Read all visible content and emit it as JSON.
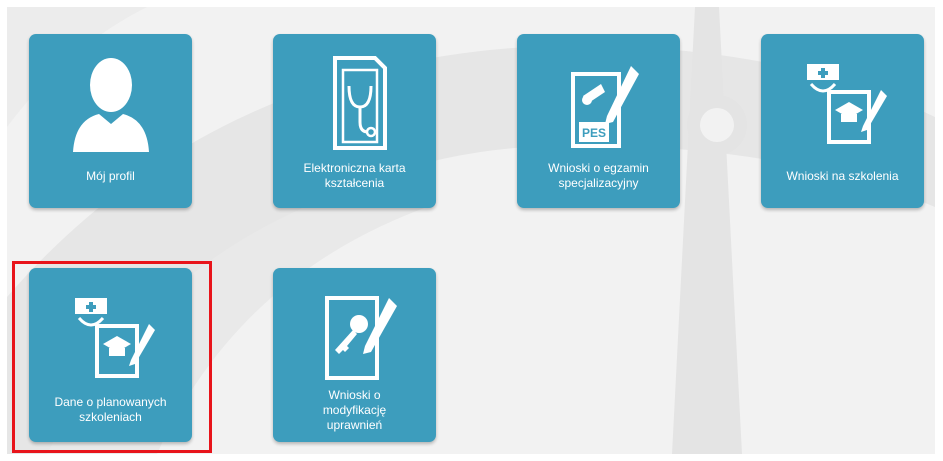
{
  "tiles": [
    {
      "id": "profile",
      "label": "Mój profil",
      "icon": "user-silhouette-icon"
    },
    {
      "id": "ekk",
      "label": "Elektroniczna karta\nkształcenia",
      "icon": "stethoscope-card-icon"
    },
    {
      "id": "pes",
      "label": "Wnioski o egzamin\nspecjalizacyjny",
      "icon": "pes-diploma-icon",
      "badge": "PES"
    },
    {
      "id": "trainings",
      "label": "Wnioski na szkolenia",
      "icon": "nurse-cap-graduation-icon"
    },
    {
      "id": "planned",
      "label": "Dane o planowanych\nszkoleniach",
      "icon": "nurse-cap-graduation-icon"
    },
    {
      "id": "permissions",
      "label": "Wnioski o\nmodyfikację\nuprawnień",
      "icon": "key-document-icon"
    }
  ],
  "colors": {
    "tile": "#3d9dbd",
    "highlight": "#e8141b",
    "background": "#f2f2f2"
  }
}
